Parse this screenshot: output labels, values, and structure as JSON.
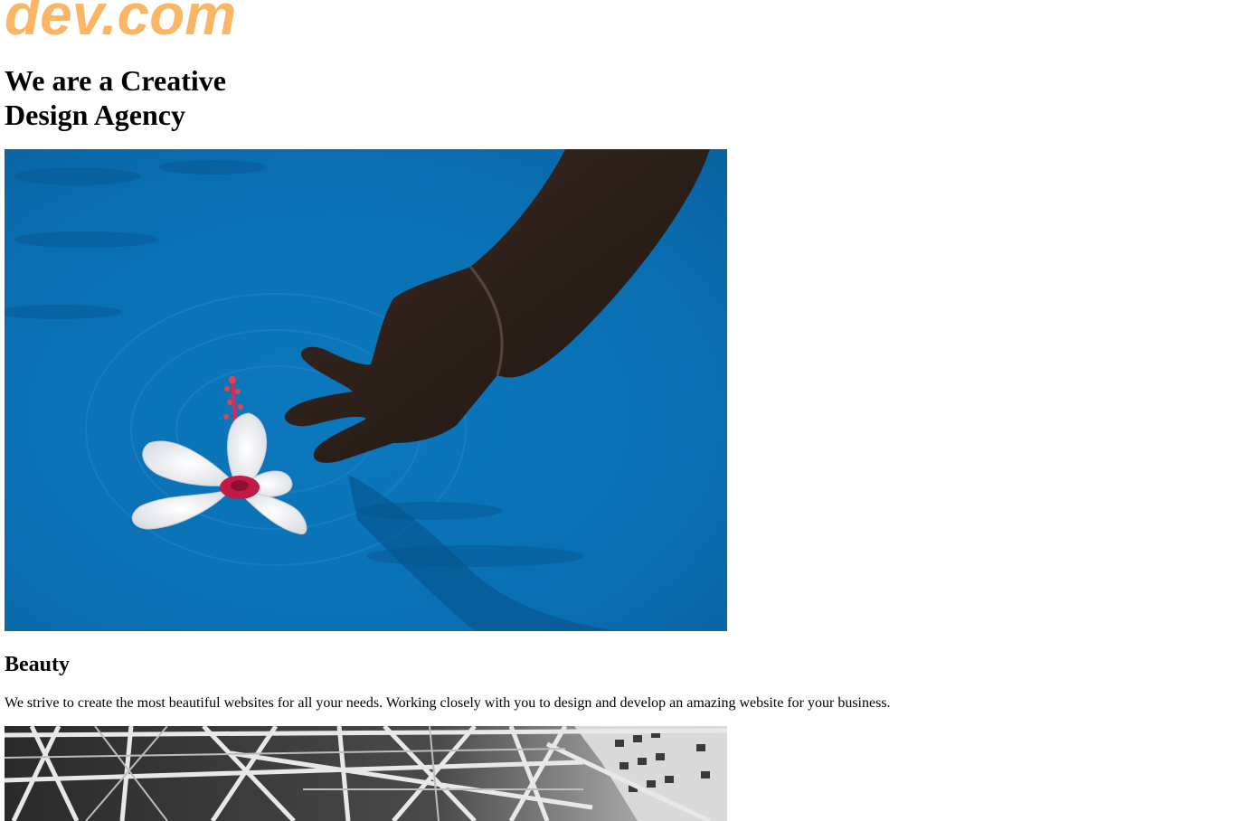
{
  "brand": {
    "logo_text": "dev.com",
    "logo_color": "#fbb665"
  },
  "hero": {
    "headline_line1": "We are a Creative",
    "headline_line2": "Design Agency",
    "photo": {
      "subject": "hand placing a white hibiscus flower on blue pool water",
      "water_color": "#0a72b6",
      "flower_color": "#f4f1f2",
      "flower_center_color": "#c21a48"
    }
  },
  "sections": [
    {
      "title": "Beauty",
      "text": "We strive to create the most beautiful websites for all your needs. Working closely with you to design and develop an amazing website for your business.",
      "photo": {
        "subject": "black and white steel lattice structure with building facade",
        "tone": "grayscale"
      }
    }
  ]
}
